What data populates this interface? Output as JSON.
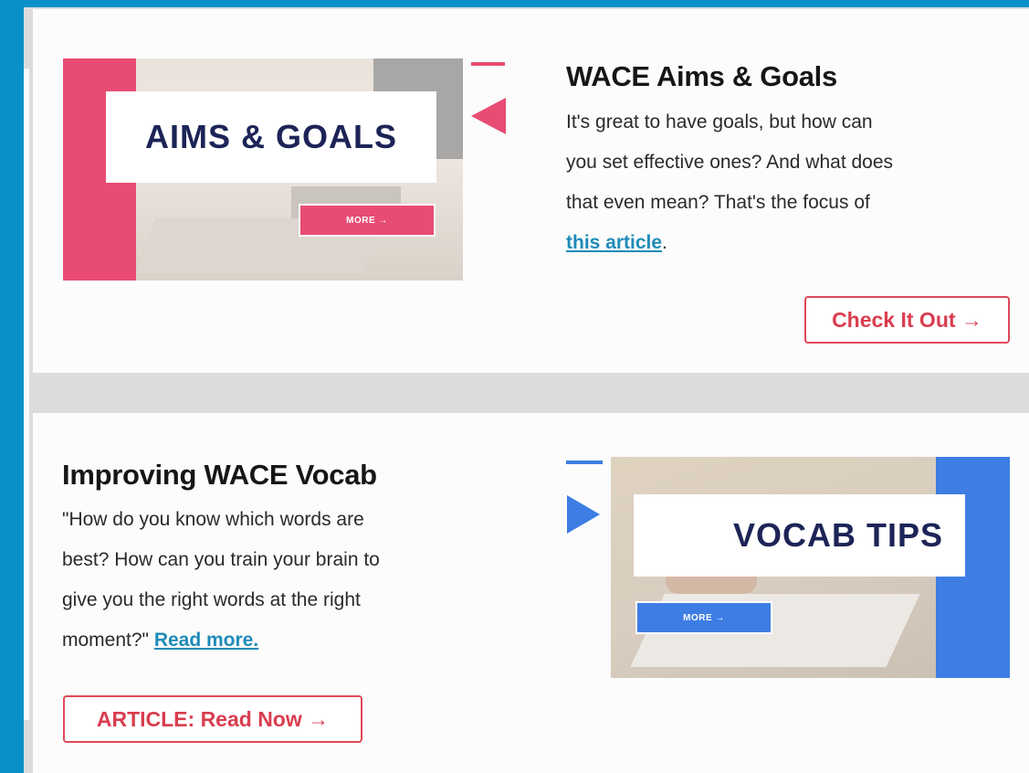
{
  "articles": [
    {
      "title": "WACE Aims & Goals",
      "body_lines": [
        "It's great to have goals, but how can",
        "you set effective ones? And what does",
        "that even mean? That's the focus of"
      ],
      "link_text": "this article",
      "link_suffix": ".",
      "button_label": "Check It Out →",
      "thumbnail_label": "AIMS & GOALS",
      "thumbnail_more": "MORE →"
    },
    {
      "title": "Improving WACE Vocab",
      "body_lines": [
        "\"How do you know which words are",
        "best? How can you train your brain to",
        "give you the right words at the right"
      ],
      "body_last_prefix": "moment?\" ",
      "link_text": "Read more.",
      "button_label": "ARTICLE: Read Now →",
      "thumbnail_label": "VOCAB TIPS",
      "thumbnail_more": "MORE →"
    }
  ],
  "colors": {
    "frame_blue": "#0a90c8",
    "pink_accent": "#e84c72",
    "blue_accent": "#3d7de4",
    "cta_red": "#d93d4f",
    "link_blue": "#1e8bb8",
    "label_navy": "#1c2457"
  },
  "icons": {
    "triangle_left": "pointer-left-icon",
    "triangle_right": "pointer-right-icon"
  }
}
